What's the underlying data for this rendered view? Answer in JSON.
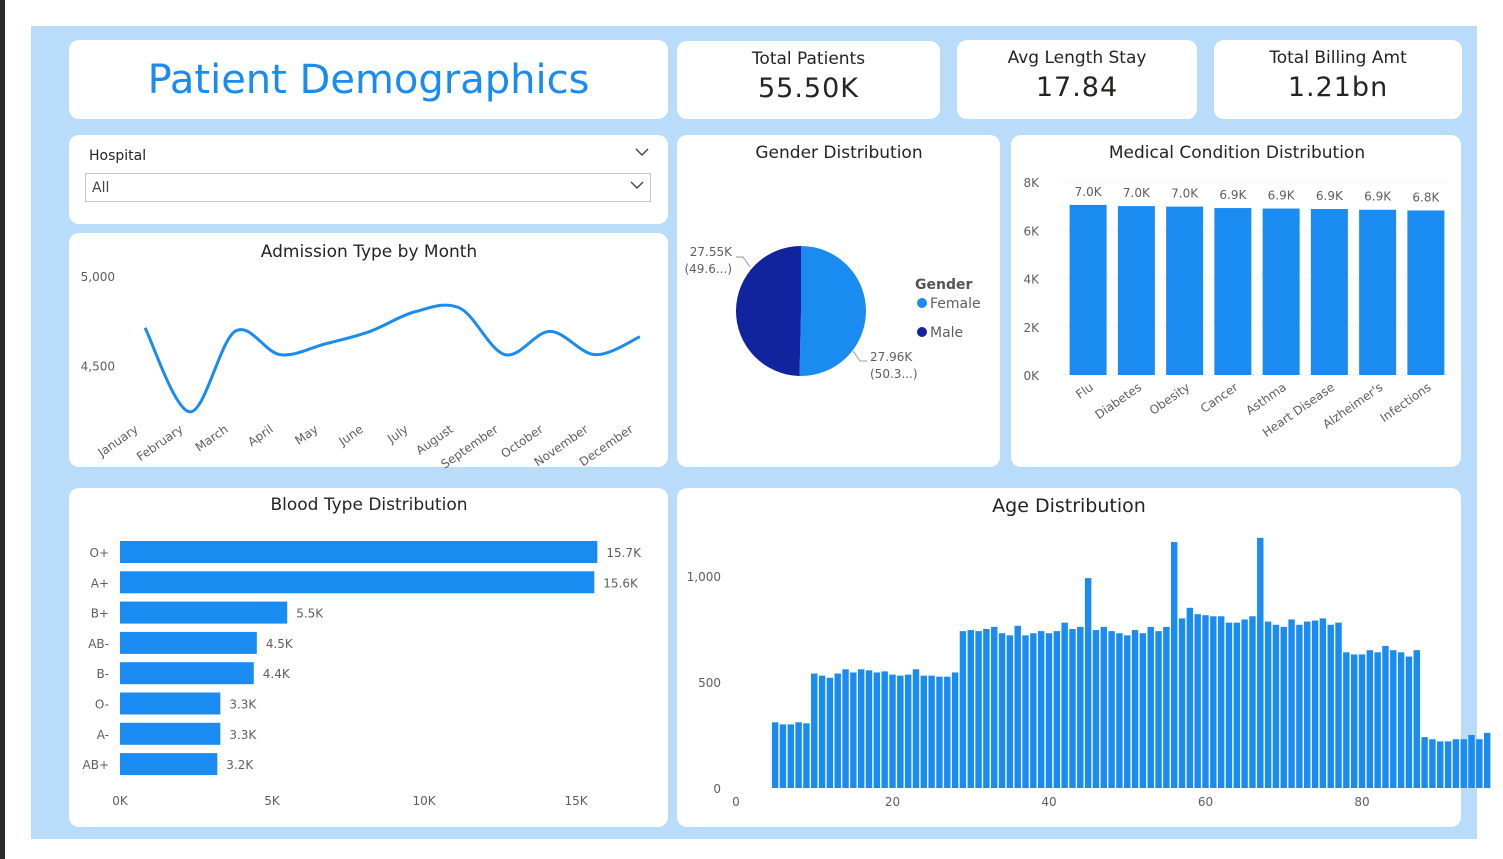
{
  "header": {
    "title": "Patient Demographics"
  },
  "kpis": [
    {
      "label": "Total Patients",
      "value": "55.50K"
    },
    {
      "label": "Avg Length Stay",
      "value": "17.84"
    },
    {
      "label": "Total Billing Amt",
      "value": "1.21bn"
    }
  ],
  "slicer": {
    "label": "Hospital",
    "value": "All"
  },
  "colors": {
    "accent": "#1a8cf1",
    "male": "#12239e",
    "bar": "#1a8cf1"
  },
  "chart_data": [
    {
      "id": "admission",
      "type": "line",
      "title": "Admission Type by Month",
      "categories": [
        "January",
        "February",
        "March",
        "April",
        "May",
        "June",
        "July",
        "August",
        "September",
        "October",
        "November",
        "December"
      ],
      "values": [
        4710,
        4240,
        4690,
        4560,
        4620,
        4690,
        4800,
        4820,
        4560,
        4690,
        4560,
        4660
      ],
      "yticks": [
        "5,000",
        "4,500"
      ],
      "ylim": [
        4200,
        5000
      ]
    },
    {
      "id": "gender",
      "type": "pie",
      "title": "Gender Distribution",
      "legend_title": "Gender",
      "slices": [
        {
          "name": "Female",
          "value": 27.96,
          "label": "27.96K",
          "pct": "(50.3...)",
          "color": "#1a8cf1"
        },
        {
          "name": "Male",
          "value": 27.55,
          "label": "27.55K",
          "pct": "(49.6...)",
          "color": "#12239e"
        }
      ]
    },
    {
      "id": "medical",
      "type": "bar",
      "title": "Medical Condition Distribution",
      "categories": [
        "Flu",
        "Diabetes",
        "Obesity",
        "Cancer",
        "Asthma",
        "Heart Disease",
        "Alzheimer's",
        "Infections"
      ],
      "values": [
        7.05,
        7.0,
        6.98,
        6.92,
        6.9,
        6.88,
        6.85,
        6.82
      ],
      "labels": [
        "7.0K",
        "7.0K",
        "7.0K",
        "6.9K",
        "6.9K",
        "6.9K",
        "6.9K",
        "6.8K"
      ],
      "yticks": [
        "0K",
        "2K",
        "4K",
        "6K",
        "8K"
      ],
      "ylim": [
        0,
        8
      ]
    },
    {
      "id": "blood",
      "type": "bar",
      "title": "Blood Type Distribution",
      "categories": [
        "O+",
        "A+",
        "B+",
        "AB-",
        "B-",
        "O-",
        "A-",
        "AB+"
      ],
      "values": [
        15.7,
        15.6,
        5.5,
        4.5,
        4.4,
        3.3,
        3.3,
        3.2
      ],
      "labels": [
        "15.7K",
        "15.6K",
        "5.5K",
        "4.5K",
        "4.4K",
        "3.3K",
        "3.3K",
        "3.2K"
      ],
      "xticks": [
        "0K",
        "5K",
        "10K",
        "15K"
      ],
      "xlim": [
        0,
        17.3
      ]
    },
    {
      "id": "age",
      "type": "bar",
      "title": "Age Distribution",
      "x_start": 5,
      "values": [
        310,
        300,
        300,
        310,
        305,
        540,
        530,
        520,
        540,
        560,
        545,
        560,
        555,
        545,
        550,
        535,
        530,
        535,
        560,
        530,
        530,
        525,
        525,
        545,
        740,
        745,
        740,
        750,
        760,
        730,
        720,
        765,
        720,
        730,
        740,
        730,
        740,
        780,
        750,
        760,
        990,
        745,
        760,
        740,
        730,
        720,
        745,
        730,
        760,
        740,
        760,
        1160,
        800,
        850,
        820,
        815,
        810,
        810,
        780,
        780,
        795,
        810,
        1180,
        785,
        770,
        760,
        795,
        770,
        785,
        790,
        800,
        770,
        780,
        640,
        630,
        630,
        650,
        640,
        670,
        650,
        640,
        620,
        650,
        240,
        230,
        220,
        220,
        230,
        230,
        250,
        230,
        260
      ],
      "xticks": [
        "0",
        "20",
        "40",
        "60",
        "80"
      ],
      "yticks": [
        "0",
        "500",
        "1,000"
      ],
      "ylim": [
        0,
        1250
      ]
    }
  ]
}
